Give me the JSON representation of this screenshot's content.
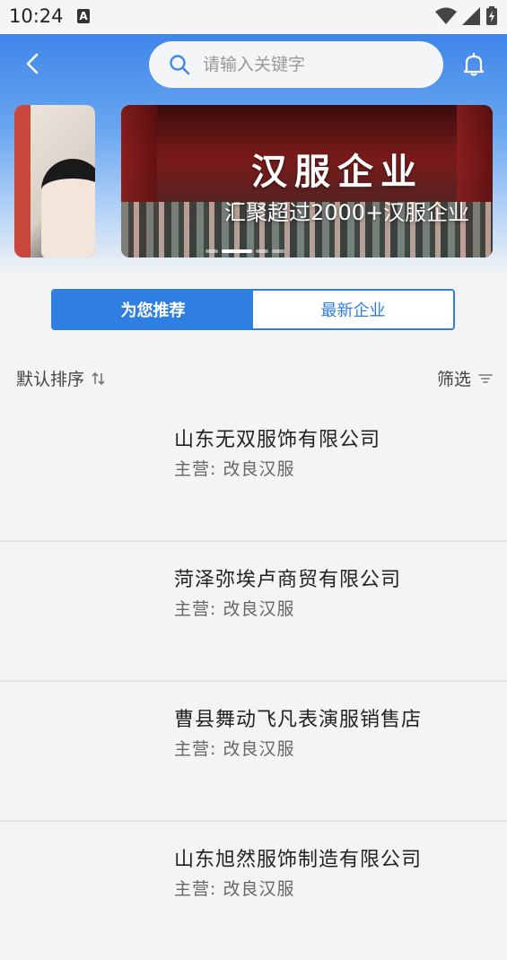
{
  "status_bar": {
    "time": "10:24",
    "notification_icon": "A"
  },
  "header": {
    "search_placeholder": "请输入关键字"
  },
  "banner": {
    "title": "汉服企业",
    "subtitle": "汇聚超过2000+汉服企业",
    "active_index": 1
  },
  "tabs": [
    {
      "label": "为您推荐",
      "active": true
    },
    {
      "label": "最新企业",
      "active": false
    }
  ],
  "toolbar": {
    "sort_label": "默认排序",
    "filter_label": "筛选"
  },
  "companies": [
    {
      "name": "山东无双服饰有限公司",
      "business": "主营: 改良汉服"
    },
    {
      "name": "菏泽弥埃卢商贸有限公司",
      "business": "主营: 改良汉服"
    },
    {
      "name": "曹县舞动飞凡表演服销售店",
      "business": "主营: 改良汉服"
    },
    {
      "name": "山东旭然服饰制造有限公司",
      "business": "主营: 改良汉服"
    }
  ],
  "colors": {
    "accent": "#2f7fe3",
    "header_top": "#3f86ea"
  }
}
